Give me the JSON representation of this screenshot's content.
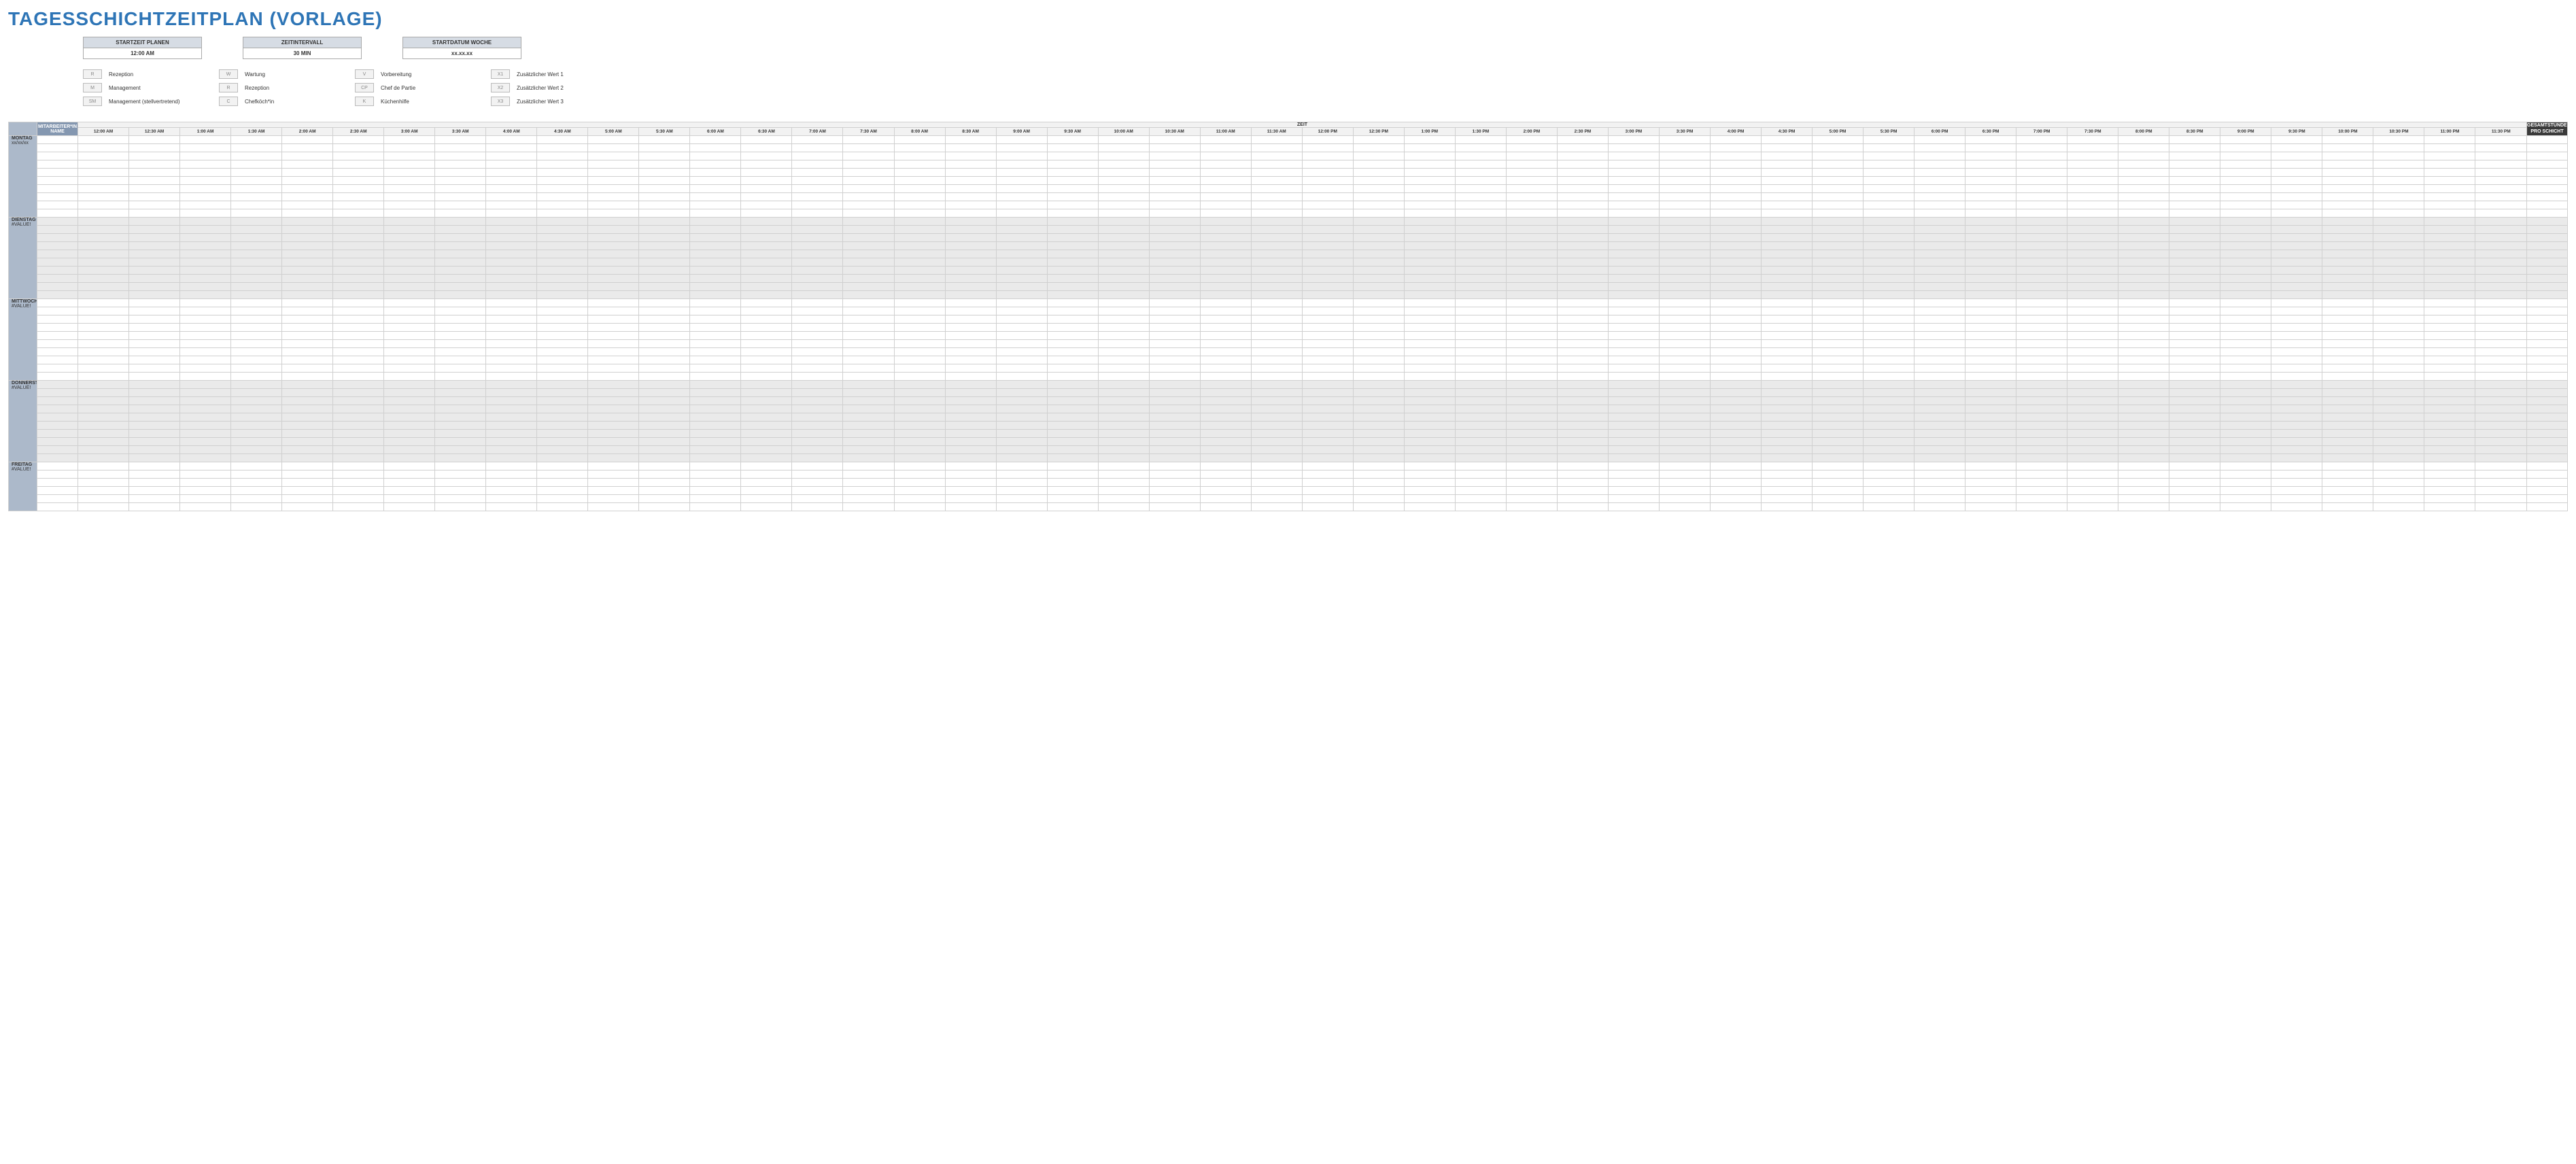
{
  "title": "TAGESSCHICHTZEITPLAN (VORLAGE)",
  "settings": [
    {
      "label": "STARTZEIT PLANEN",
      "value": "12:00 AM"
    },
    {
      "label": "ZEITINTERVALL",
      "value": "30 MIN"
    },
    {
      "label": "STARTDATUM WOCHE",
      "value": "xx.xx.xx"
    }
  ],
  "legend": [
    [
      {
        "key": "R",
        "label": "Rezeption"
      },
      {
        "key": "M",
        "label": "Management"
      },
      {
        "key": "SM",
        "label": "Management (stellvertretend)"
      }
    ],
    [
      {
        "key": "W",
        "label": "Wartung"
      },
      {
        "key": "R",
        "label": "Rezeption"
      },
      {
        "key": "C",
        "label": "Chefköch*in"
      }
    ],
    [
      {
        "key": "V",
        "label": "Vorbereitung"
      },
      {
        "key": "CP",
        "label": "Chef de Partie"
      },
      {
        "key": "K",
        "label": "Küchenhilfe"
      }
    ],
    [
      {
        "key": "X1",
        "label": "Zusätzlicher Wert 1"
      },
      {
        "key": "X2",
        "label": "Zusätzlicher Wert 2"
      },
      {
        "key": "X3",
        "label": "Zusätzlicher Wert 3"
      }
    ]
  ],
  "headers": {
    "name": "MITARBEITER*IN NAME",
    "zeit": "ZEIT",
    "total": "GESAMTSTUNDEN PRO SCHICHT"
  },
  "time_slots": [
    "12:00 AM",
    "12:30 AM",
    "1:00 AM",
    "1:30 AM",
    "2:00 AM",
    "2:30 AM",
    "3:00 AM",
    "3:30 AM",
    "4:00 AM",
    "4:30 AM",
    "5:00 AM",
    "5:30 AM",
    "6:00 AM",
    "6:30 AM",
    "7:00 AM",
    "7:30 AM",
    "8:00 AM",
    "8:30 AM",
    "9:00 AM",
    "9:30 AM",
    "10:00 AM",
    "10:30 AM",
    "11:00 AM",
    "11:30 AM",
    "12:00 PM",
    "12:30 PM",
    "1:00 PM",
    "1:30 PM",
    "2:00 PM",
    "2:30 PM",
    "3:00 PM",
    "3:30 PM",
    "4:00 PM",
    "4:30 PM",
    "5:00 PM",
    "5:30 PM",
    "6:00 PM",
    "6:30 PM",
    "7:00 PM",
    "7:30 PM",
    "8:00 PM",
    "8:30 PM",
    "9:00 PM",
    "9:30 PM",
    "10:00 PM",
    "10:30 PM",
    "11:00 PM",
    "11:30 PM"
  ],
  "days": [
    {
      "name": "MONTAG",
      "date": "xx/xx/xx",
      "rows": 10,
      "striped": false
    },
    {
      "name": "DIENSTAG",
      "date": "#VALUE!",
      "rows": 10,
      "striped": true
    },
    {
      "name": "MITTWOCH",
      "date": "#VALUE!",
      "rows": 10,
      "striped": false
    },
    {
      "name": "DONNERSTAG",
      "date": "#VALUE!",
      "rows": 10,
      "striped": true
    },
    {
      "name": "FREITAG",
      "date": "#VALUE!",
      "rows": 6,
      "striped": false
    }
  ]
}
